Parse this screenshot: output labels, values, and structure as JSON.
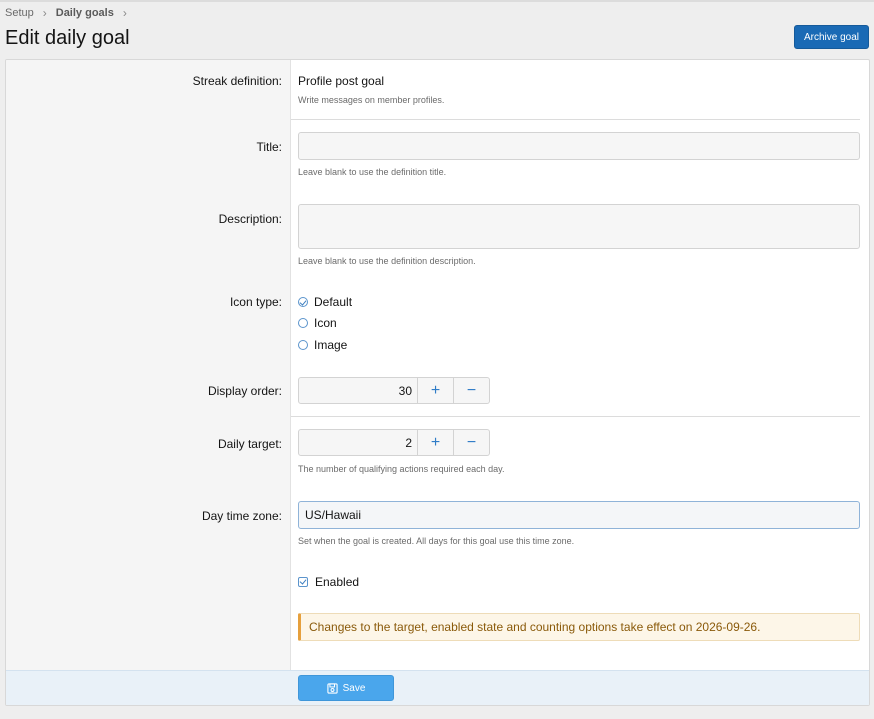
{
  "breadcrumb": {
    "items": [
      "Setup",
      "Daily goals"
    ],
    "separator": "›"
  },
  "page_title": "Edit daily goal",
  "archive_button_label": "Archive goal",
  "streak": {
    "label": "Streak definition:",
    "value": "Profile post goal",
    "hint": "Write messages on member profiles."
  },
  "title_field": {
    "label": "Title:",
    "value": "",
    "hint": "Leave blank to use the definition title."
  },
  "description_field": {
    "label": "Description:",
    "value": "",
    "hint": "Leave blank to use the definition description."
  },
  "icon_type": {
    "label": "Icon type:",
    "options": [
      {
        "label": "Default",
        "checked": true
      },
      {
        "label": "Icon",
        "checked": false
      },
      {
        "label": "Image",
        "checked": false
      }
    ]
  },
  "display_order": {
    "label": "Display order:",
    "value": "30"
  },
  "daily_target": {
    "label": "Daily target:",
    "value": "2",
    "hint": "The number of qualifying actions required each day."
  },
  "timezone": {
    "label": "Day time zone:",
    "value": "US/Hawaii",
    "hint": "Set when the goal is created. All days for this goal use this time zone."
  },
  "enabled": {
    "label": "Enabled",
    "checked": true
  },
  "notice": "Changes to the target, enabled state and counting options take effect on 2026-09-26.",
  "save_button_label": "Save",
  "stepper": {
    "plus": "+",
    "minus": "−"
  },
  "colors": {
    "primary": "#1a6ab5",
    "save": "#4aa6ec",
    "notice_border": "#e6a03d",
    "notice_text": "#8a5a0a"
  },
  "icons": {
    "save": "floppy-disk-icon",
    "plus": "plus-icon",
    "minus": "minus-icon"
  }
}
